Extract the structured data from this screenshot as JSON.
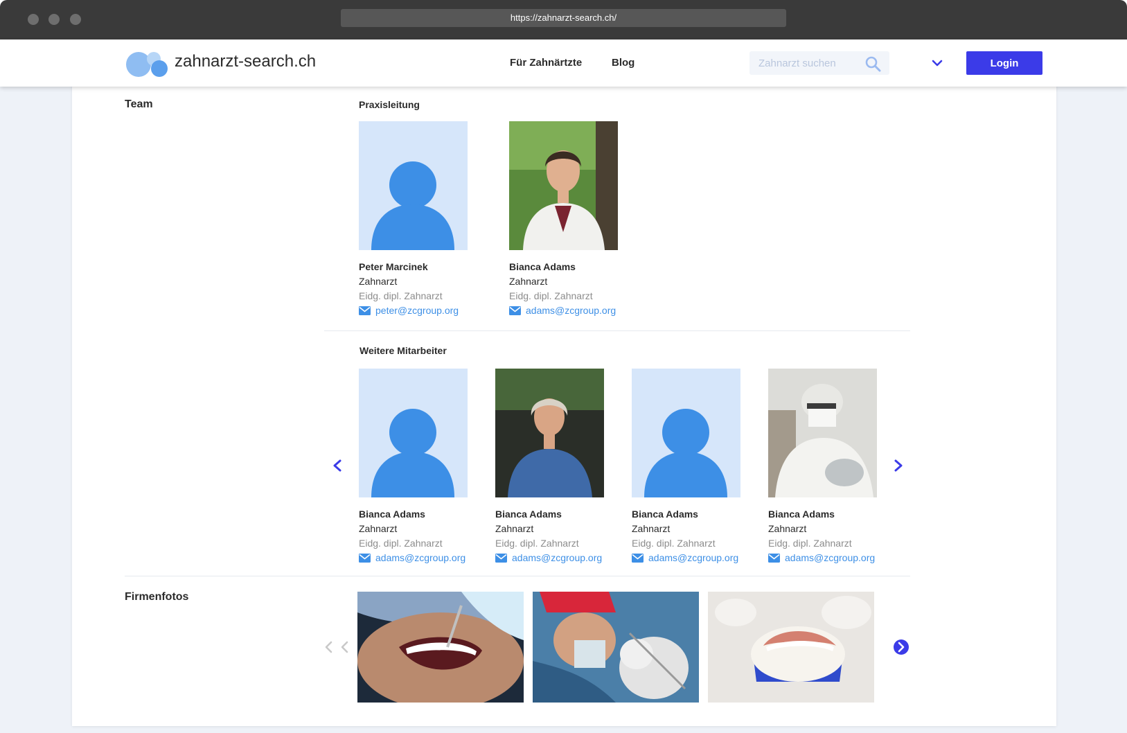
{
  "browser": {
    "url": "https://zahnarzt-search.ch/"
  },
  "header": {
    "brand": "zahnarzt-search.ch",
    "nav": [
      "Für Zahnärtzte",
      "Blog"
    ],
    "search_placeholder": "Zahnarzt suchen",
    "login_label": "Login"
  },
  "team": {
    "title": "Team",
    "leadership_title": "Praxisleitung",
    "leadership": [
      {
        "name": "Peter Marcinek",
        "role": "Zahnarzt",
        "degree": "Eidg. dipl. Zahnarzt",
        "email": "peter@zcgroup.org"
      },
      {
        "name": "Bianca Adams",
        "role": "Zahnarzt",
        "degree": "Eidg. dipl. Zahnarzt",
        "email": "adams@zcgroup.org"
      }
    ],
    "staff_title": "Weitere Mitarbeiter",
    "staff": [
      {
        "name": "Bianca Adams",
        "role": "Zahnarzt",
        "degree": "Eidg. dipl. Zahnarzt",
        "email": "adams@zcgroup.org"
      },
      {
        "name": "Bianca Adams",
        "role": "Zahnarzt",
        "degree": "Eidg. dipl. Zahnarzt",
        "email": "adams@zcgroup.org"
      },
      {
        "name": "Bianca Adams",
        "role": "Zahnarzt",
        "degree": "Eidg. dipl. Zahnarzt",
        "email": "adams@zcgroup.org"
      },
      {
        "name": "Bianca Adams",
        "role": "Zahnarzt",
        "degree": "Eidg. dipl. Zahnarzt",
        "email": "adams@zcgroup.org"
      }
    ]
  },
  "company_photos": {
    "title": "Firmenfotos"
  },
  "colors": {
    "accent": "#3b3be8",
    "link": "#3d8fe6",
    "avatar": "#3d8fe6",
    "avatar_bg": "#d6e6fa"
  }
}
